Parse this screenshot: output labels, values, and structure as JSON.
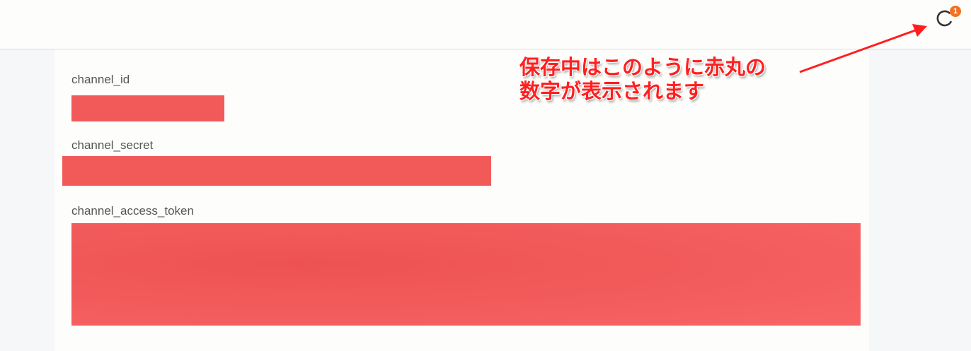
{
  "header": {
    "sync_icon": "refresh-icon",
    "badge_count": "1",
    "badge_color": "#f07020"
  },
  "form": {
    "fields": [
      {
        "label": "channel_id"
      },
      {
        "label": "channel_secret"
      },
      {
        "label": "channel_access_token"
      }
    ],
    "redaction_color": "#f25a5a"
  },
  "annotation": {
    "line1": "保存中はこのように赤丸の",
    "line2": "数字が表示されます",
    "color": "#ff1f1f"
  }
}
